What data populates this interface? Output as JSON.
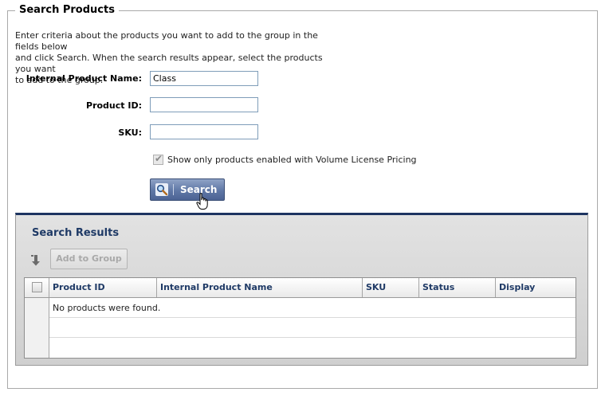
{
  "panel": {
    "title": "Search Products",
    "intro_lines": [
      "Enter criteria about the products you want to add to the group in the fields below",
      "and click Search. When the search results appear, select the products you want",
      "to add to the group."
    ]
  },
  "form": {
    "internal_name_label": "Internal Product Name:",
    "internal_name_value": "Class",
    "product_id_label": "Product ID:",
    "product_id_value": "",
    "sku_label": "SKU:",
    "sku_value": "",
    "volume_checkbox_label": "Show only products enabled with Volume License Pricing",
    "volume_checkbox_checked": true,
    "search_button_label": "Search"
  },
  "results": {
    "title": "Search Results",
    "add_button_label": "Add to Group",
    "columns": [
      "Product ID",
      "Internal Product Name",
      "SKU",
      "Status",
      "Display"
    ],
    "empty_message": "No products were found."
  },
  "icons": {
    "search": "magnifier-icon",
    "sort": "down-arrow-icon",
    "cursor": "hand-pointer-icon"
  },
  "colors": {
    "accent_navy": "#1d3461",
    "heading_blue": "#1f3a66",
    "button_blue": "#5f77a6"
  }
}
